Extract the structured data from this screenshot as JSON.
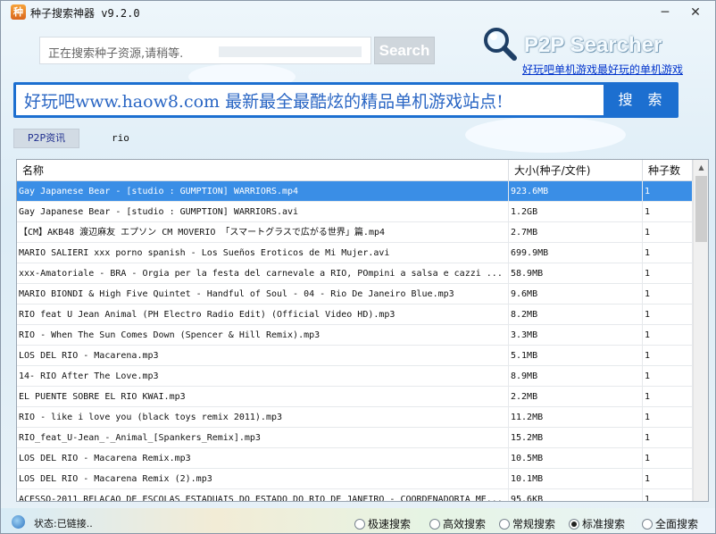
{
  "window": {
    "title": "种子搜索神器 v9.2.0",
    "minimize_glyph": "─",
    "close_glyph": "✕"
  },
  "search": {
    "placeholder": "正在搜索种子资源,请稍等.",
    "button_label": "Search"
  },
  "logo": {
    "text": "P2P Searcher",
    "icon": "magnifier-icon"
  },
  "promo_link": "好玩吧单机游戏最好玩的单机游戏",
  "ad": {
    "text": "好玩吧www.haow8.com 最新最全最酷炫的精品单机游戏站点!",
    "button_label": "搜 索"
  },
  "tabs": [
    {
      "label": "P2P资讯"
    }
  ],
  "query": "rio",
  "table": {
    "headers": [
      "名称",
      "大小(种子/文件)",
      "种子数"
    ],
    "rows": [
      {
        "name": "Gay Japanese Bear - [studio : GUMPTION] WARRIORS.mp4",
        "size": "923.6MB",
        "seeds": "1",
        "selected": true
      },
      {
        "name": "Gay Japanese Bear - [studio : GUMPTION] WARRIORS.avi",
        "size": "1.2GB",
        "seeds": "1"
      },
      {
        "name": "【CM】AKB48 渡辺麻友 エプソン CM MOVERIO 「スマートグラスで広がる世界」篇.mp4",
        "size": "2.7MB",
        "seeds": "1"
      },
      {
        "name": "MARIO SALIERI xxx porno spanish - Los Sueños Eroticos de Mi Mujer.avi",
        "size": "699.9MB",
        "seeds": "1"
      },
      {
        "name": "xxx-Amatoriale - BRA - Orgia per la festa del carnevale a RIO, POmpini a salsa e cazzi ...",
        "size": "58.9MB",
        "seeds": "1"
      },
      {
        "name": "MARIO BIONDI & High Five Quintet - Handful of Soul - 04 - Rio De Janeiro Blue.mp3",
        "size": "9.6MB",
        "seeds": "1"
      },
      {
        "name": "RIO feat U Jean Animal (PH Electro Radio Edit) (Official Video HD).mp3",
        "size": "8.2MB",
        "seeds": "1"
      },
      {
        "name": "RIO - When The Sun Comes Down (Spencer & Hill Remix).mp3",
        "size": "3.3MB",
        "seeds": "1"
      },
      {
        "name": "LOS DEL RIO - Macarena.mp3",
        "size": "5.1MB",
        "seeds": "1"
      },
      {
        "name": "14- RIO After The Love.mp3",
        "size": "8.9MB",
        "seeds": "1"
      },
      {
        "name": "EL PUENTE SOBRE EL RIO KWAI.mp3",
        "size": "2.2MB",
        "seeds": "1"
      },
      {
        "name": "RIO - like i love you (black toys remix 2011).mp3",
        "size": "11.2MB",
        "seeds": "1"
      },
      {
        "name": "RIO_feat_U-Jean_-_Animal_[Spankers_Remix].mp3",
        "size": "15.2MB",
        "seeds": "1"
      },
      {
        "name": "LOS DEL RIO - Macarena Remix.mp3",
        "size": "10.5MB",
        "seeds": "1"
      },
      {
        "name": "LOS DEL RIO - Macarena Remix (2).mp3",
        "size": "10.1MB",
        "seeds": "1"
      },
      {
        "name": "ACESSO-2011_RELACAO_DE_ESCOLAS_ESTADUAIS_DO_ESTADO_DO_RIO_DE_JANEIRO_-_COORDENADORIA_ME...",
        "size": "95.6KB",
        "seeds": "1"
      }
    ]
  },
  "status": {
    "text": "状态:已链接.."
  },
  "modes": [
    {
      "label": "极速搜索",
      "checked": false
    },
    {
      "label": "高效搜索",
      "checked": false
    },
    {
      "label": "常规搜索",
      "checked": false
    },
    {
      "label": "标准搜索",
      "checked": true
    },
    {
      "label": "全面搜索",
      "checked": false
    }
  ],
  "colors": {
    "selection": "#3a8ee6",
    "ad_blue": "#1c6fd0",
    "link": "#0033cc"
  }
}
